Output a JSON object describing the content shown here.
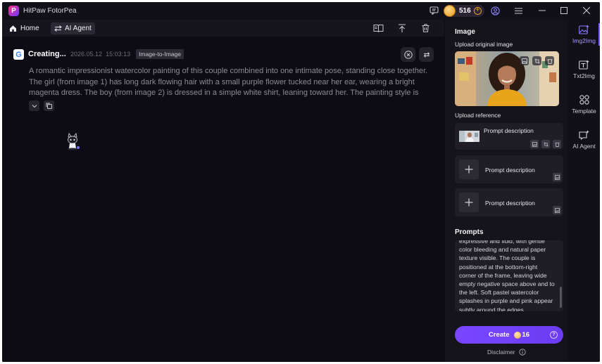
{
  "app": {
    "title": "HitPaw FotorPea",
    "logo_letter": "P",
    "coins": "516"
  },
  "nav": {
    "home_label": "Home",
    "agent_label": "AI Agent"
  },
  "message": {
    "status": "Creating...",
    "date": "2026.05.12",
    "time": "15:03:13",
    "tag": "Image-to-Image",
    "prompt": "A romantic impressionist watercolor painting of this couple combined into one intimate pose, standing close together. The girl (from image 1) has long dark flowing hair with a small purple flower tucked near her ear, wearing a bright magenta dress. The boy (from image 2) is dressed in a simple white shirt, leaning toward her. The painting style is loose..."
  },
  "panel": {
    "image_heading": "Image",
    "upload_original_label": "Upload original image",
    "upload_reference_label": "Upload reference",
    "references": [
      {
        "label": "Prompt description"
      },
      {
        "label": "Prompt description"
      },
      {
        "label": "Prompt description"
      }
    ],
    "prompts_heading": "Prompts",
    "prompts_text": "expressive and fluid, with gentle color bleeding and natural paper texture visible.  The couple is positioned at the bottom-right corner of the frame, leaving wide empty negative space above and to the left. Soft pastel watercolor splashes in purple and pink appear subtly around the edges.",
    "create_label": "Create",
    "create_cost": "16",
    "disclaimer": "Disclaimer"
  },
  "rail": {
    "items": [
      {
        "label": "Img2Img",
        "icon": "img2img-icon"
      },
      {
        "label": "Txt2Img",
        "icon": "txt2img-icon"
      },
      {
        "label": "Template",
        "icon": "template-icon"
      },
      {
        "label": "AI Agent",
        "icon": "ai-agent-icon"
      }
    ]
  },
  "colors": {
    "accent": "#7a46ff",
    "background": "#0d0b14",
    "panel": "#15141b",
    "coin": "#e5a21d"
  }
}
